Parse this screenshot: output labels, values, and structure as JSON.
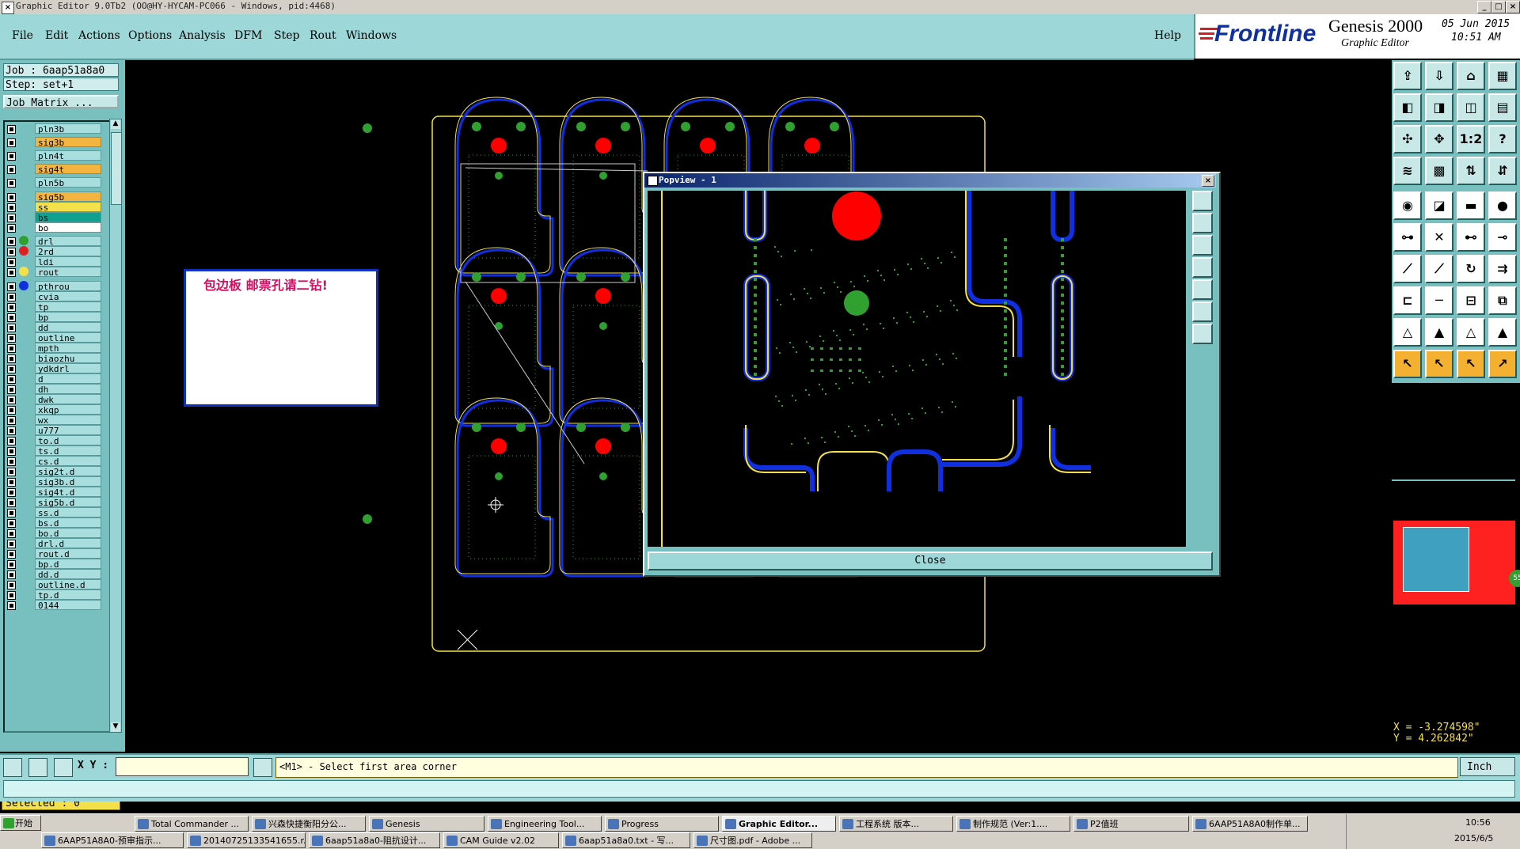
{
  "window": {
    "title": "Graphic Editor 9.0Tb2  (OO@HY-HYCAM-PC066 - Windows, pid:4468)",
    "controls": [
      "_",
      "□",
      "×"
    ]
  },
  "menu": {
    "items": [
      "File",
      "Edit",
      "Actions",
      "Options",
      "Analysis",
      "DFM",
      "Step",
      "Rout",
      "Windows"
    ],
    "help": "Help"
  },
  "brand": {
    "logo": "Frontline",
    "product": "Genesis 2000",
    "subtitle": "Graphic Editor",
    "date": "05 Jun 2015",
    "time": "10:51 AM"
  },
  "job": {
    "job_label": "Job : 6aap51a8a0",
    "step_label": "Step: set+1",
    "matrix_button": "Job Matrix ..."
  },
  "layers": [
    {
      "name": "pln3b",
      "color": "#a8dede",
      "swatch": ""
    },
    {
      "name": "sig3b",
      "color": "#f4b440",
      "swatch": ""
    },
    {
      "name": "pln4t",
      "color": "#a8dede",
      "swatch": ""
    },
    {
      "name": "sig4t",
      "color": "#f4b440",
      "swatch": ""
    },
    {
      "name": "pln5b",
      "color": "#a8dede",
      "swatch": ""
    },
    {
      "name": "sig5b",
      "color": "#f4b440",
      "swatch": ""
    },
    {
      "name": "ss",
      "color": "#f4e04a",
      "swatch": ""
    },
    {
      "name": "bs",
      "color": "#10a090",
      "swatch": ""
    },
    {
      "name": "bo",
      "color": "#ffffff",
      "swatch": ""
    },
    {
      "name": "drl",
      "color": "#a8dede",
      "swatch": "#30a030"
    },
    {
      "name": "2rd",
      "color": "#a8dede",
      "swatch": "#e02020"
    },
    {
      "name": "ldi",
      "color": "#a8dede",
      "swatch": ""
    },
    {
      "name": "rout",
      "color": "#a8dede",
      "swatch": "#f4e04a"
    },
    {
      "name": "pthrou",
      "color": "#a8dede",
      "swatch": "#1030e0"
    },
    {
      "name": "cvia",
      "color": "#a8dede",
      "swatch": ""
    },
    {
      "name": "tp",
      "color": "#a8dede",
      "swatch": ""
    },
    {
      "name": "bp",
      "color": "#a8dede",
      "swatch": ""
    },
    {
      "name": "dd",
      "color": "#a8dede",
      "swatch": ""
    },
    {
      "name": "outline",
      "color": "#a8dede",
      "swatch": ""
    },
    {
      "name": "mpth",
      "color": "#a8dede",
      "swatch": ""
    },
    {
      "name": "biaozhu",
      "color": "#a8dede",
      "swatch": ""
    },
    {
      "name": "ydkdrl",
      "color": "#a8dede",
      "swatch": ""
    },
    {
      "name": "d",
      "color": "#a8dede",
      "swatch": ""
    },
    {
      "name": "dh",
      "color": "#a8dede",
      "swatch": ""
    },
    {
      "name": "dwk",
      "color": "#a8dede",
      "swatch": ""
    },
    {
      "name": "xkqp",
      "color": "#a8dede",
      "swatch": ""
    },
    {
      "name": "wx",
      "color": "#a8dede",
      "swatch": ""
    },
    {
      "name": "u777",
      "color": "#a8dede",
      "swatch": ""
    },
    {
      "name": "to.d",
      "color": "#a8dede",
      "swatch": ""
    },
    {
      "name": "ts.d",
      "color": "#a8dede",
      "swatch": ""
    },
    {
      "name": "cs.d",
      "color": "#a8dede",
      "swatch": ""
    },
    {
      "name": "sig2t.d",
      "color": "#a8dede",
      "swatch": ""
    },
    {
      "name": "sig3b.d",
      "color": "#a8dede",
      "swatch": ""
    },
    {
      "name": "sig4t.d",
      "color": "#a8dede",
      "swatch": ""
    },
    {
      "name": "sig5b.d",
      "color": "#a8dede",
      "swatch": ""
    },
    {
      "name": "ss.d",
      "color": "#a8dede",
      "swatch": ""
    },
    {
      "name": "bs.d",
      "color": "#a8dede",
      "swatch": ""
    },
    {
      "name": "bo.d",
      "color": "#a8dede",
      "swatch": ""
    },
    {
      "name": "drl.d",
      "color": "#a8dede",
      "swatch": ""
    },
    {
      "name": "rout.d",
      "color": "#a8dede",
      "swatch": ""
    },
    {
      "name": "bp.d",
      "color": "#a8dede",
      "swatch": ""
    },
    {
      "name": "dd.d",
      "color": "#a8dede",
      "swatch": ""
    },
    {
      "name": "outline.d",
      "color": "#a8dede",
      "swatch": ""
    },
    {
      "name": "tp.d",
      "color": "#a8dede",
      "swatch": ""
    },
    {
      "name": "0144",
      "color": "#a8dede",
      "swatch": ""
    }
  ],
  "selected_label": "Selected : 0",
  "note_text": "包边板   邮票孔请二钻!",
  "popview": {
    "title": "Popview - 1",
    "close_label": "Close"
  },
  "coords": {
    "x": "X = -3.274598\"",
    "y": "Y = 4.262842\""
  },
  "status": {
    "xy_label": "X Y :",
    "xy_value": "",
    "prompt": "<M1> - Select first area corner",
    "units": "Inch"
  },
  "taskbar": {
    "start": "开始",
    "row1": [
      "Total Commander ...",
      "兴森快捷衡阳分公...",
      "Genesis",
      "Engineering Tool...",
      "Progress",
      "Graphic Editor...",
      "工程系统  版本...",
      "制作规范 (Ver:1....",
      "P2值班",
      "6AAP51A8A0制作单..."
    ],
    "row2": [
      "6AAP51A8A0-预审指示...",
      "20140725133541655.r...",
      "6aap51a8a0-阻抗设计...",
      "CAM Guide v2.02",
      "6aap51a8a0.txt - 写...",
      "尺寸图.pdf - Adobe ..."
    ],
    "clock_time": "10:56",
    "clock_date": "2015/6/5"
  },
  "colors": {
    "panel": "#78c0c0",
    "menubar": "#9dd7d7",
    "highlight": "#f4e04a",
    "pad_red": "#ff0000",
    "pad_green": "#30a030",
    "rout_yellow": "#f4e04a",
    "copper_blue": "#1030e0"
  }
}
